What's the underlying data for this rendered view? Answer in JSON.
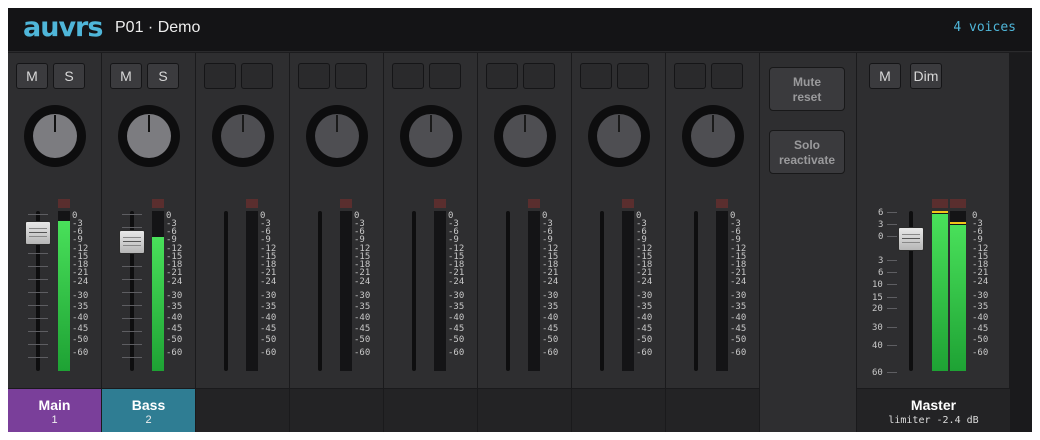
{
  "app": {
    "logo": "auvrs",
    "project": "P01 · Demo",
    "voices": "4 voices"
  },
  "colors": {
    "accent": "#4fb6d9",
    "main_label": "#7a3f9a",
    "bass_label": "#2f7d93",
    "meter_green": "#49e05a"
  },
  "meter_scale": [
    "0",
    "-3",
    "-6",
    "-9",
    "-12",
    "-15",
    "-18",
    "-21",
    "-24",
    "-30",
    "-35",
    "-40",
    "-45",
    "-50",
    "-60"
  ],
  "channels": [
    {
      "name": "Main",
      "number": "1",
      "mute": "M",
      "solo": "S",
      "active": true,
      "level": 0.94,
      "meter": 0.94
    },
    {
      "name": "Bass",
      "number": "2",
      "mute": "M",
      "solo": "S",
      "active": true,
      "level": 0.88,
      "meter": 0.84
    },
    {
      "name": "",
      "number": "",
      "mute": "",
      "solo": "",
      "active": false,
      "level": 0,
      "meter": 0
    },
    {
      "name": "",
      "number": "",
      "mute": "",
      "solo": "",
      "active": false,
      "level": 0,
      "meter": 0
    },
    {
      "name": "",
      "number": "",
      "mute": "",
      "solo": "",
      "active": false,
      "level": 0,
      "meter": 0
    },
    {
      "name": "",
      "number": "",
      "mute": "",
      "solo": "",
      "active": false,
      "level": 0,
      "meter": 0
    },
    {
      "name": "",
      "number": "",
      "mute": "",
      "solo": "",
      "active": false,
      "level": 0,
      "meter": 0
    },
    {
      "name": "",
      "number": "",
      "mute": "",
      "solo": "",
      "active": false,
      "level": 0,
      "meter": 0
    }
  ],
  "fx": {
    "mute_reset": [
      "Mute",
      "reset"
    ],
    "solo_reactivate": [
      "Solo",
      "reactivate"
    ]
  },
  "master": {
    "name": "Master",
    "mute": "M",
    "dim": "Dim",
    "limiter": "limiter  -2.4 dB",
    "gain_scale": [
      "6",
      "3",
      "0",
      "3",
      "6",
      "10",
      "15",
      "20",
      "30",
      "40",
      "60"
    ],
    "meter_left": 0.98,
    "meter_right": 0.91
  }
}
